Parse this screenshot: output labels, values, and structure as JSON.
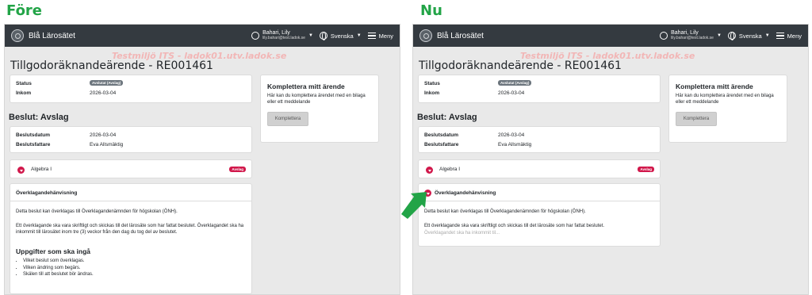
{
  "labels": {
    "before": "Före",
    "after": "Nu"
  },
  "app": {
    "brand": "Blå Lärosätet",
    "user_name": "Bahari, Lily",
    "user_email": "lily.bahari@test.ladok.se",
    "language": "Svenska",
    "menu_label": "Meny",
    "watermark": "Testmiljö ITS - ladok01.utv.ladok.se"
  },
  "page": {
    "title": "Tillgodoräknandeärende - RE001461",
    "status_label": "Status",
    "status_value": "Avslutat (Avslag)",
    "inkom_label": "Inkom",
    "inkom_value": "2026-03-04",
    "decision_title": "Beslut: Avslag",
    "beslutsdatum_label": "Beslutsdatum",
    "beslutsdatum_value": "2026-03-04",
    "beslutsfattare_label": "Beslutsfattare",
    "beslutsfattare_value": "Eva Allsmäktig",
    "course_name": "Algebra I",
    "course_badge": "Avslag"
  },
  "komplettera": {
    "title": "Komplettera mitt ärende",
    "text": "Här kan du komplettera ärendet med en bilaga eller ett meddelande",
    "button": "Komplettera"
  },
  "appeal": {
    "title": "Överklagandehänvisning",
    "p1": "Detta beslut kan överklagas till Överklagandenämnden för högskolan (ÖNH).",
    "p2": "Ett överklagande ska vara skriftligt och skickas till det lärosäte som har fattat beslutet. Överklagandet ska ha inkommit till lärosätet inom tre (3) veckor från den dag du tog del av beslutet.",
    "p2_short_line1": "Ett överklagande ska vara skriftligt och skickas till det lärosäte som har fattat beslutet.",
    "p2_short_line2": "Överklagandet ska ha inkommit til...",
    "req_title": "Uppgifter som ska ingå",
    "req_items": [
      "Vilket beslut som överklagas.",
      "Vilken ändring som begärs.",
      "Skälen till att beslutet bör ändras."
    ]
  },
  "colors": {
    "heading_green": "#22a447",
    "accent_red": "#d1184b",
    "navbar": "#343a40"
  }
}
